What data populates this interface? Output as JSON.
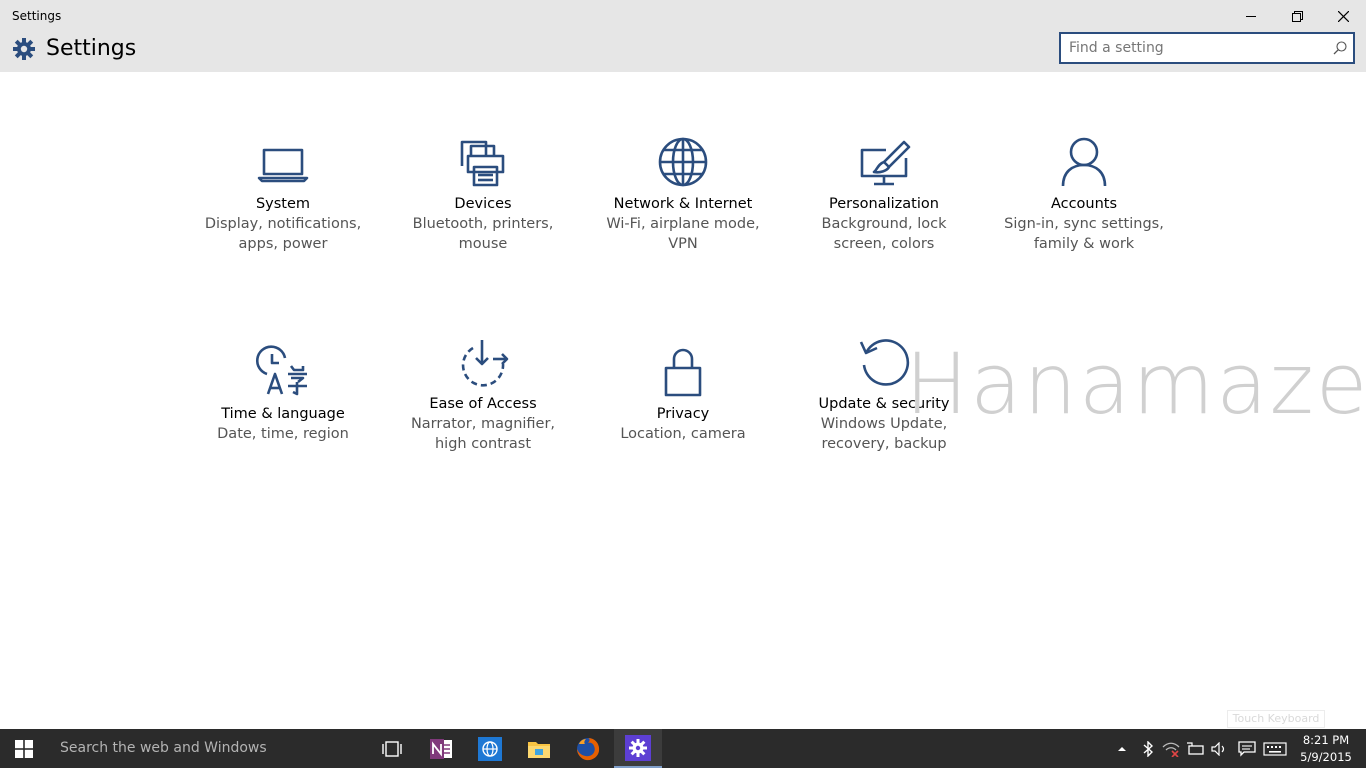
{
  "window": {
    "title": "Settings"
  },
  "header": {
    "title": "Settings",
    "search_placeholder": "Find a setting"
  },
  "categories": [
    {
      "name": "System",
      "desc1": "Display, notifications,",
      "desc2": "apps, power",
      "icon": "laptop-icon"
    },
    {
      "name": "Devices",
      "desc1": "Bluetooth, printers,",
      "desc2": "mouse",
      "icon": "printer-icon"
    },
    {
      "name": "Network & Internet",
      "desc1": "Wi-Fi, airplane mode,",
      "desc2": "VPN",
      "icon": "globe-icon"
    },
    {
      "name": "Personalization",
      "desc1": "Background, lock",
      "desc2": "screen, colors",
      "icon": "paintbrush-monitor-icon"
    },
    {
      "name": "Accounts",
      "desc1": "Sign-in, sync settings,",
      "desc2": "family & work",
      "icon": "person-icon"
    },
    {
      "name": "Time & language",
      "desc1": "Date, time, region",
      "desc2": "",
      "icon": "clock-language-icon"
    },
    {
      "name": "Ease of Access",
      "desc1": "Narrator, magnifier,",
      "desc2": "high contrast",
      "icon": "ease-of-access-icon"
    },
    {
      "name": "Privacy",
      "desc1": "Location, camera",
      "desc2": "",
      "icon": "lock-icon"
    },
    {
      "name": "Update & security",
      "desc1": "Windows Update,",
      "desc2": "recovery, backup",
      "icon": "refresh-icon"
    }
  ],
  "watermark": "Hanamaze",
  "touch_keyboard_tooltip": "Touch Keyboard",
  "taskbar": {
    "search_text": "Search the web and Windows",
    "apps": [
      "task-view-icon",
      "onenote-icon",
      "ie-icon",
      "file-explorer-icon",
      "firefox-icon",
      "settings-icon"
    ],
    "time": "8:21 PM",
    "date": "5/9/2015"
  },
  "colors": {
    "accent": "#2b4d7e",
    "titlebar": "#e6e6e6",
    "taskbar": "#2b2b2b"
  }
}
